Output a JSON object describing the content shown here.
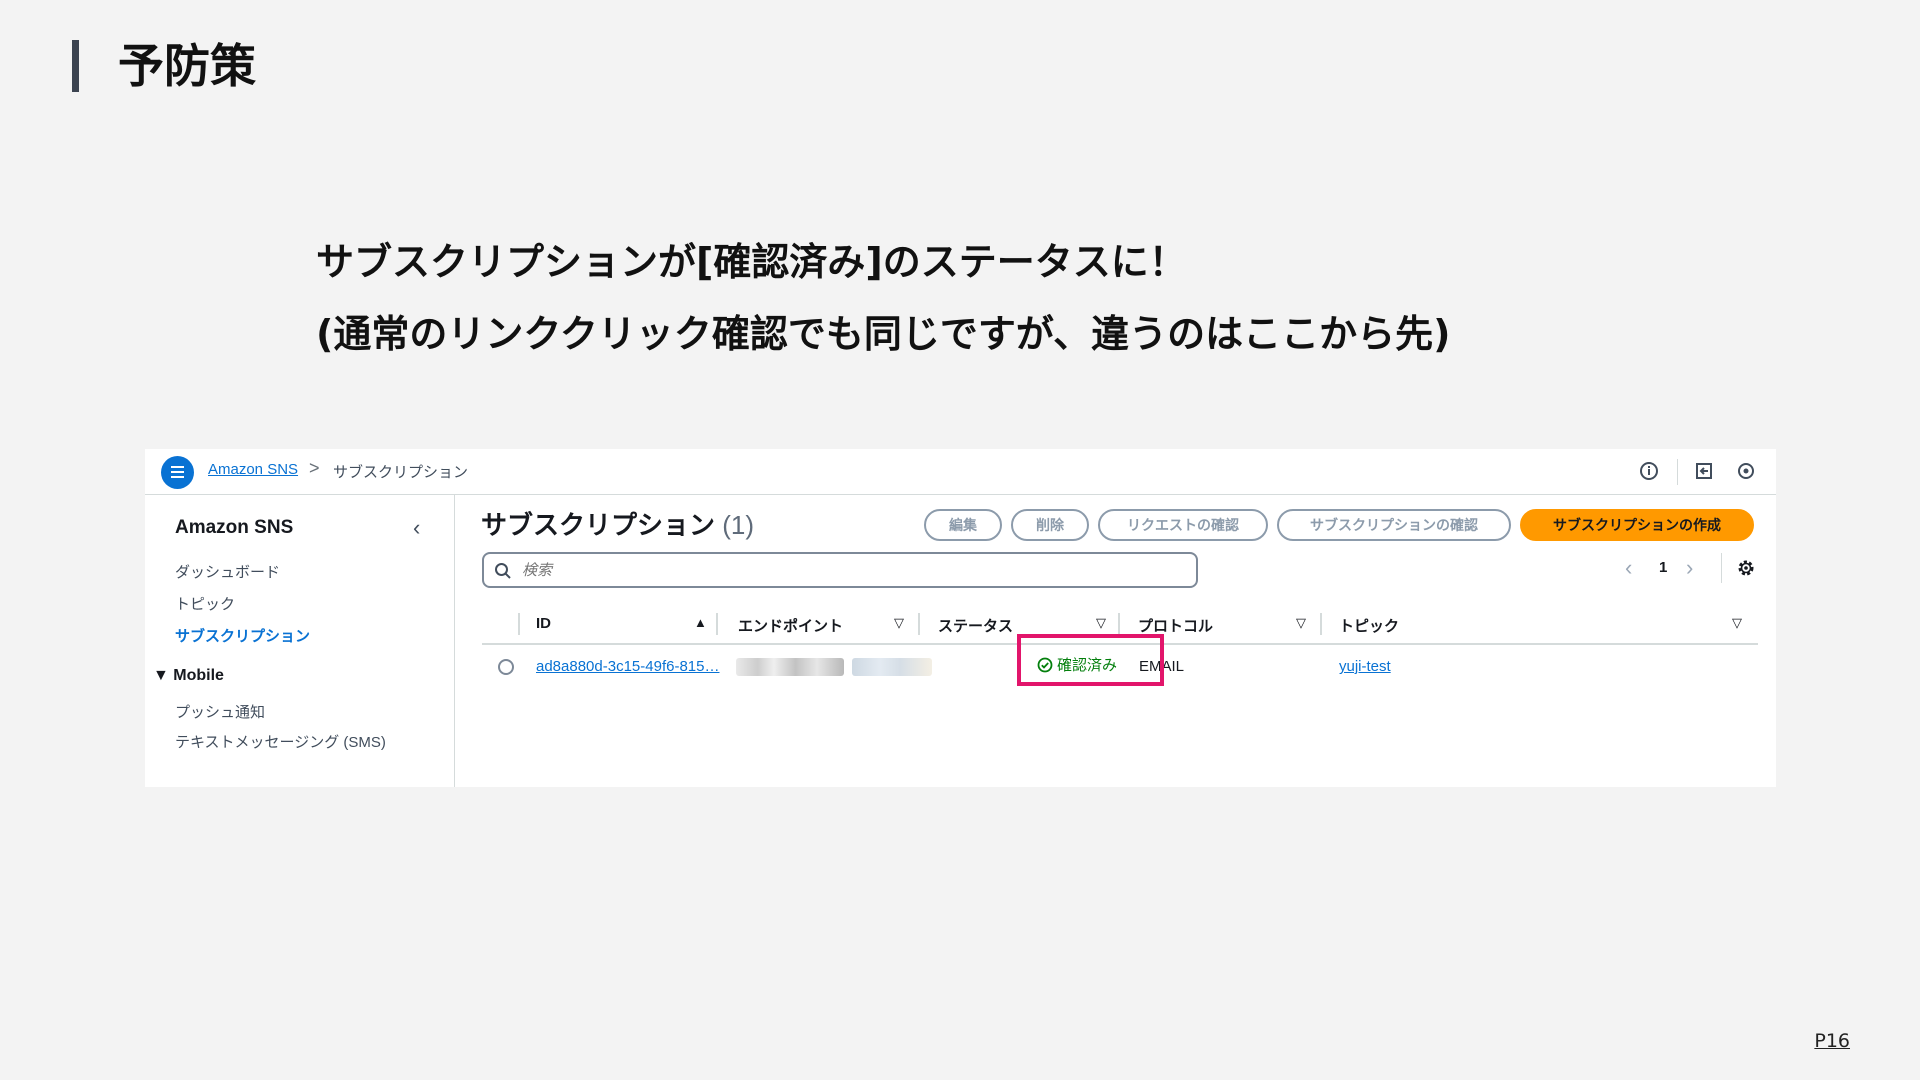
{
  "slide": {
    "title": "予防策",
    "lead_line1": "サブスクリプションが[確認済み]のステータスに！",
    "lead_line2": "(通常のリンククリック確認でも同じですが、違うのはここから先)",
    "page_number": "P16"
  },
  "console": {
    "breadcrumb": {
      "service": "Amazon SNS",
      "separator": ">",
      "current": "サブスクリプション"
    },
    "top_icons": [
      "info-icon",
      "export-icon",
      "feedback-icon"
    ],
    "sidebar": {
      "title": "Amazon SNS",
      "collapse_glyph": "‹",
      "items": [
        {
          "label": "ダッシュボード",
          "active": false
        },
        {
          "label": "トピック",
          "active": false
        },
        {
          "label": "サブスクリプション",
          "active": true
        }
      ],
      "section": {
        "label": "▼ Mobile",
        "items": [
          {
            "label": "プッシュ通知"
          },
          {
            "label": "テキストメッセージング (SMS)"
          }
        ]
      }
    },
    "main": {
      "title": "サブスクリプション",
      "count": "(1)",
      "buttons": {
        "edit": "編集",
        "delete": "削除",
        "request_confirm": "リクエストの確認",
        "subscription_confirm": "サブスクリプションの確認",
        "create": "サブスクリプションの作成"
      },
      "search_placeholder": "検索",
      "pagination": {
        "prev": "‹",
        "page": "1",
        "next": "›"
      },
      "table": {
        "columns": [
          {
            "label": "ID",
            "sort": "▲"
          },
          {
            "label": "エンドポイント",
            "sort": "▽"
          },
          {
            "label": "ステータス",
            "sort": "▽"
          },
          {
            "label": "プロトコル",
            "sort": "▽"
          },
          {
            "label": "トピック",
            "sort": "▽"
          }
        ],
        "rows": [
          {
            "id": "ad8a880d-3c15-49f6-815…",
            "endpoint": "",
            "status": "確認済み",
            "protocol": "EMAIL",
            "topic": "yuji-test"
          }
        ]
      }
    },
    "colors": {
      "link": "#0972d3",
      "primary_button": "#ff9900",
      "status_success": "#037f0c",
      "highlight": "#e2156b"
    }
  }
}
